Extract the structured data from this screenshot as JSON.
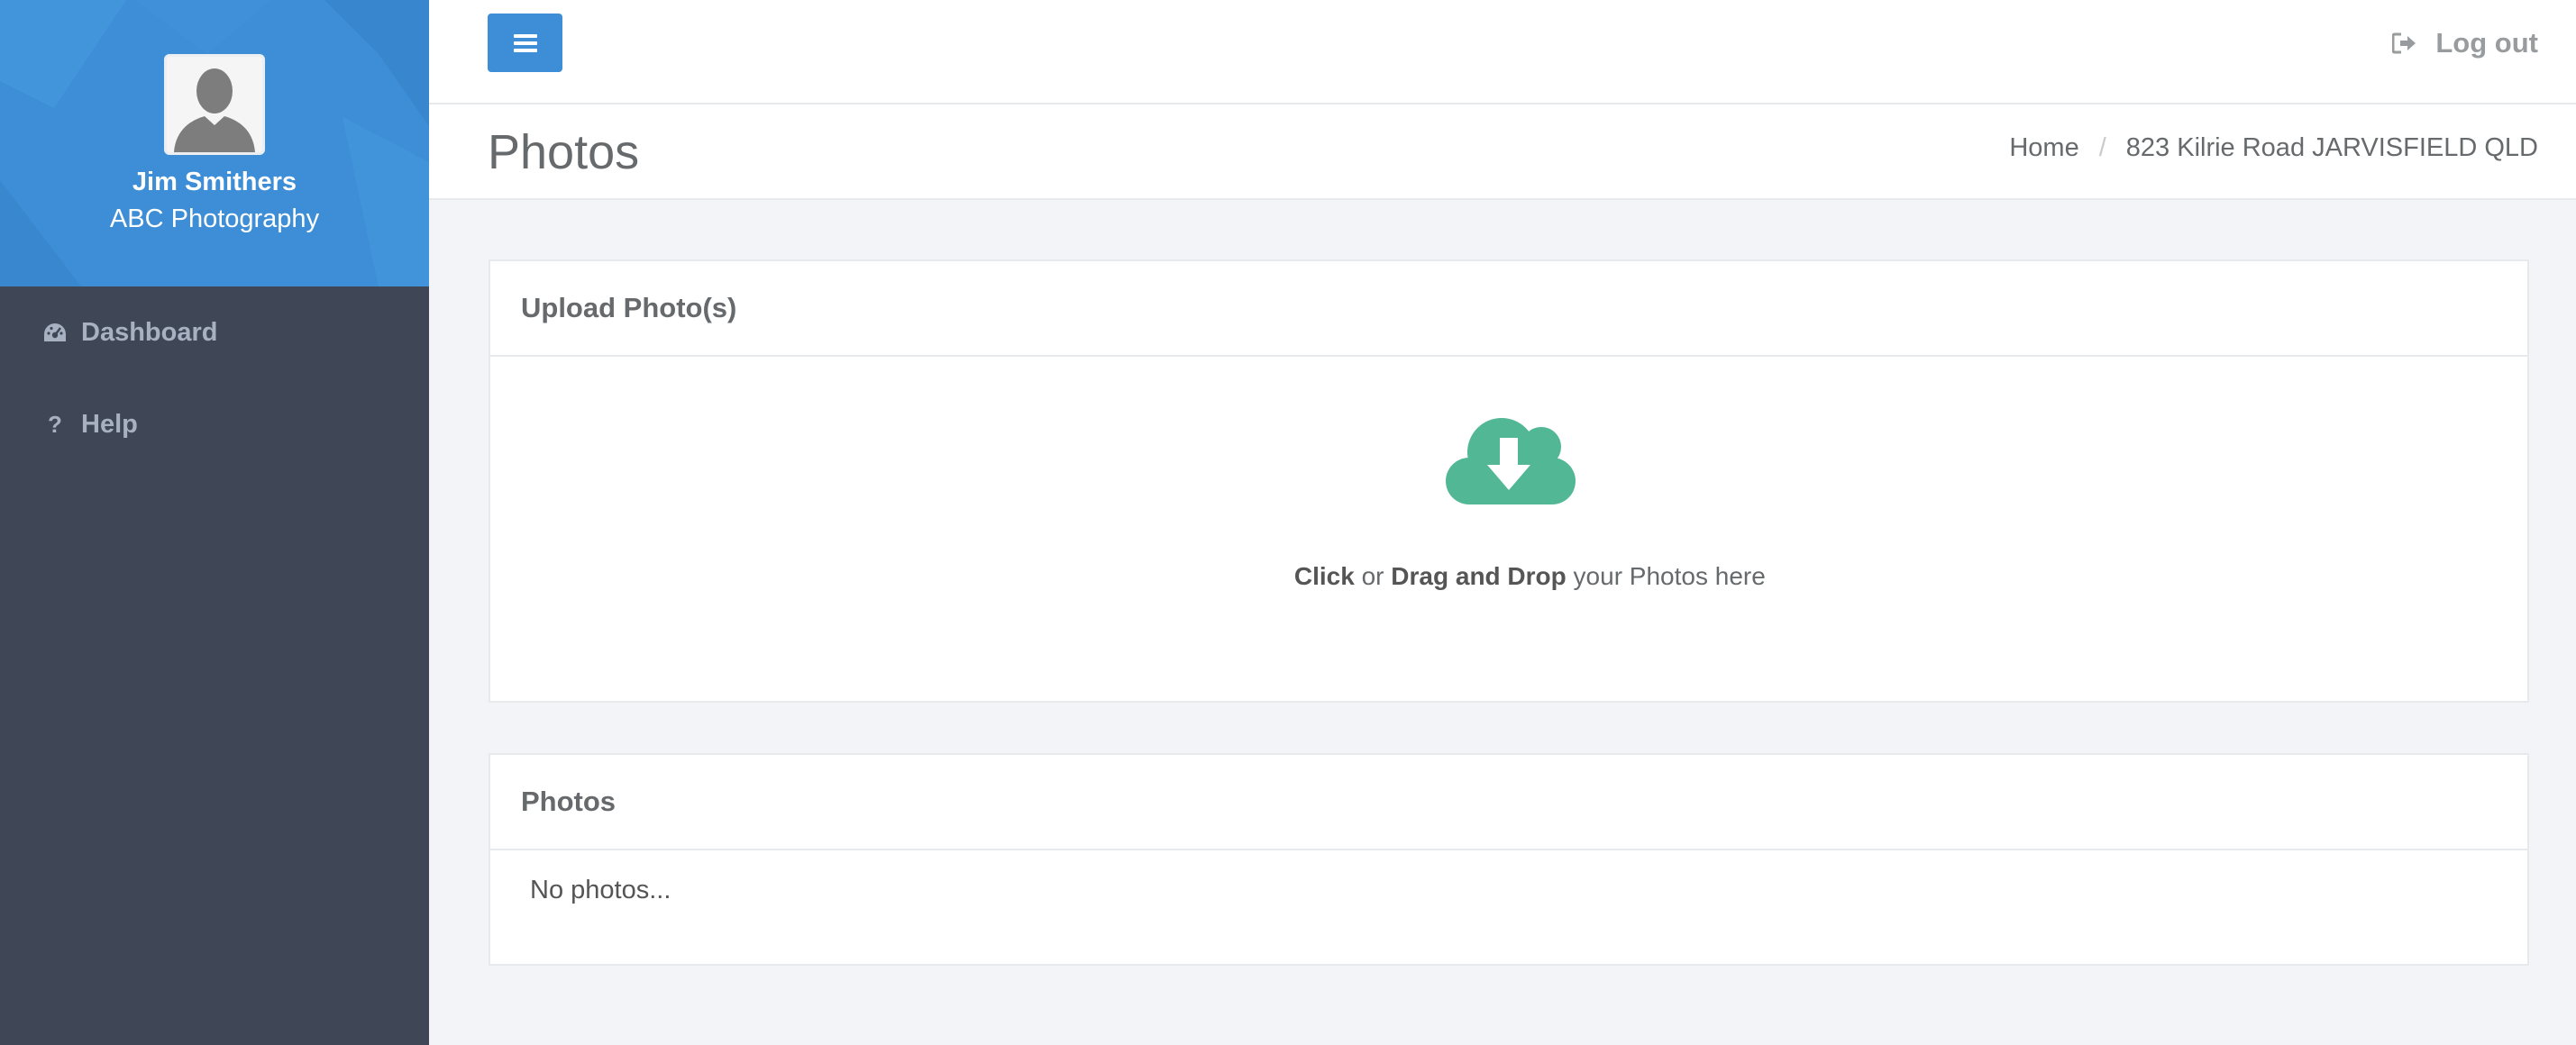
{
  "user": {
    "name": "Jim Smithers",
    "company": "ABC Photography"
  },
  "sidebar": {
    "items": [
      {
        "label": "Dashboard",
        "icon": "dashboard-icon"
      },
      {
        "label": "Help",
        "icon": "question-icon"
      }
    ]
  },
  "topbar": {
    "menu_icon": "hamburger-icon",
    "logout_label": "Log out",
    "logout_icon": "sign-out-icon"
  },
  "page": {
    "title": "Photos",
    "breadcrumb": [
      "Home",
      "823 Kilrie Road JARVISFIELD QLD"
    ]
  },
  "upload": {
    "title": "Upload Photo(s)",
    "icon": "cloud-download-icon",
    "text_click": "Click",
    "text_or": " or ",
    "text_drag": "Drag and Drop",
    "text_rest": " your Photos here"
  },
  "photos": {
    "title": "Photos",
    "empty_text": "No photos..."
  },
  "colors": {
    "accent": "#3d8ed6",
    "sidebar_bg": "#3f4757",
    "upload_icon": "#52b795",
    "page_bg": "#f3f4f7"
  }
}
